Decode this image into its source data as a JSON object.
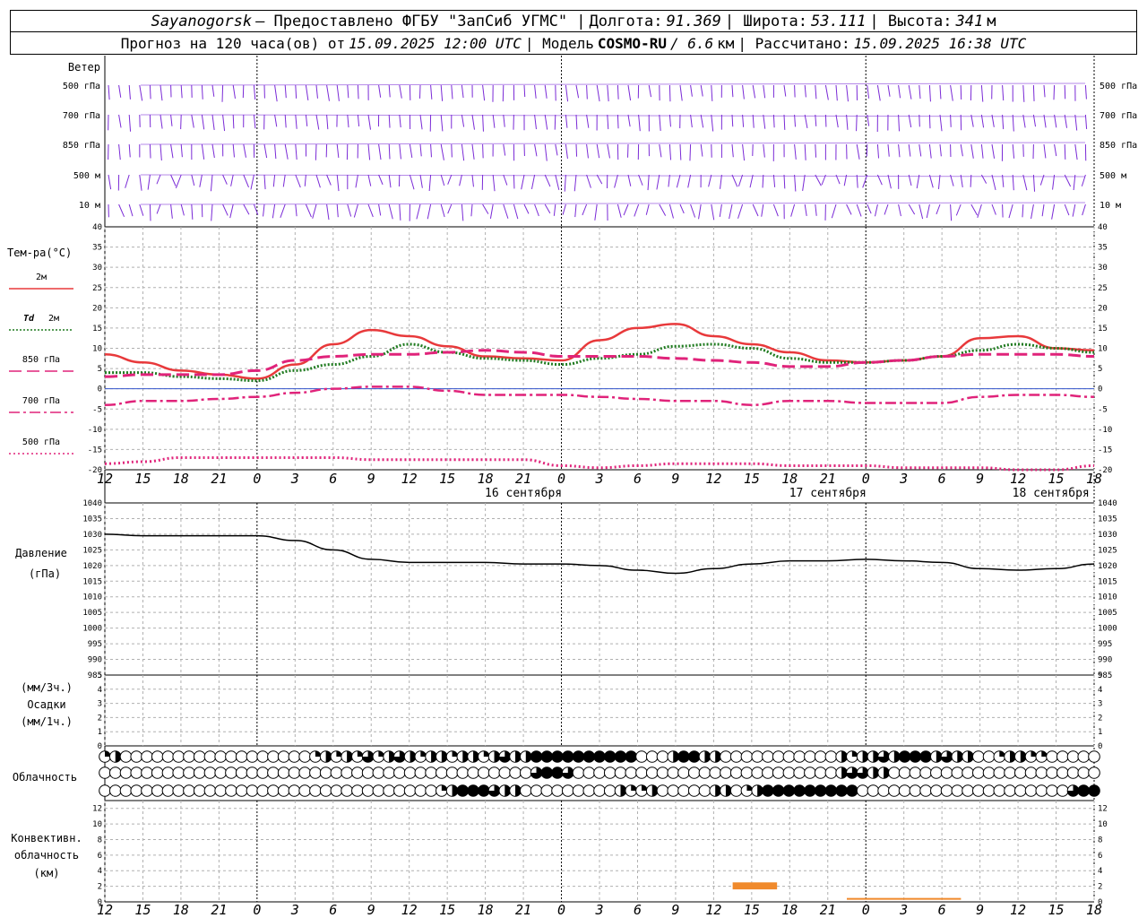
{
  "header": {
    "station": "Sayanogorsk",
    "provider": "— Предоставлено ФГБУ \"ЗапСиб УГМС\" |",
    "lon_label": "Долгота:",
    "lon_value": "91.369",
    "lat_label": "| Широта:",
    "lat_value": "53.111",
    "alt_label": "| Высота:",
    "alt_value": "341",
    "alt_unit": "м",
    "forecast_label": "Прогноз на 120 часа(ов) от",
    "forecast_start": "15.09.2025 12:00 UTC",
    "model_label": "| Модель",
    "model_name": "COSMO-RU",
    "model_res": "/ 6.6",
    "model_res_unit": "км",
    "computed_label": "| Рассчитано:",
    "computed_at": "15.09.2025 16:38 UTC"
  },
  "wind": {
    "title": "Ветер",
    "levels": [
      "500 гПа",
      "700 гПа",
      "850 гПа",
      "500 м",
      "10 м"
    ]
  },
  "temperature": {
    "title": "Тем-ра(°С)",
    "legend": [
      {
        "label": "2м",
        "label_td": "",
        "color": "#e8393b",
        "style": "solid"
      },
      {
        "label": "2м",
        "label_td": "Td",
        "color": "#1f7a1f",
        "style": "dotted"
      },
      {
        "label": "850 гПа",
        "label_td": "",
        "color": "#e0237a",
        "style": "dashed"
      },
      {
        "label": "700 гПа",
        "label_td": "",
        "color": "#e0237a",
        "style": "dashdot"
      },
      {
        "label": "500 гПа",
        "label_td": "",
        "color": "#e0237a",
        "style": "fine"
      }
    ],
    "yticks": [
      "40",
      "35",
      "30",
      "25",
      "20",
      "15",
      "10",
      "5",
      "0",
      "-5",
      "-10",
      "-15",
      "-20"
    ]
  },
  "time_axis": {
    "hour_ticks": [
      "12",
      "15",
      "18",
      "21",
      "0",
      "3",
      "6",
      "9",
      "12",
      "15",
      "18",
      "21",
      "0",
      "3",
      "6",
      "9",
      "12",
      "15",
      "18",
      "21",
      "0",
      "3",
      "6",
      "9",
      "12",
      "15",
      "18"
    ],
    "dates": [
      "16 сентября",
      "17 сентября",
      "18 сентября"
    ]
  },
  "pressure": {
    "title": "Давление",
    "unit": "(гПа)",
    "yticks": [
      "1040",
      "1035",
      "1030",
      "1025",
      "1020",
      "1015",
      "1010",
      "1005",
      "1000",
      "995",
      "990",
      "985"
    ]
  },
  "precip": {
    "unit3": "(мм/3ч.)",
    "title": "Осадки",
    "unit1": "(мм/1ч.)",
    "yticks": [
      "5",
      "4",
      "3",
      "2",
      "1",
      "0"
    ]
  },
  "clouds": {
    "title": "Облачность"
  },
  "convective": {
    "title1": "Конвективн.",
    "title2": "облачность",
    "unit": "(км)",
    "yticks": [
      "12",
      "10",
      "8",
      "6",
      "4",
      "2",
      "0"
    ]
  },
  "chart_data": {
    "type": "line",
    "x_hours_from_start": [
      0,
      3,
      6,
      9,
      12,
      15,
      18,
      21,
      24,
      27,
      30,
      33,
      36,
      39,
      42,
      45,
      48,
      51,
      54,
      57,
      60,
      63,
      66,
      69,
      72,
      75,
      78
    ],
    "x_tick_labels_utc": [
      "12",
      "15",
      "18",
      "21",
      "0",
      "3",
      "6",
      "9",
      "12",
      "15",
      "18",
      "21",
      "0",
      "3",
      "6",
      "9",
      "12",
      "15",
      "18",
      "21",
      "0",
      "3",
      "6",
      "9",
      "12",
      "15",
      "18"
    ],
    "temperature_panel": {
      "ylim": [
        -20,
        40
      ],
      "series": [
        {
          "name": "2м",
          "color": "#e8393b",
          "values": [
            8.5,
            6.5,
            4.5,
            3.5,
            2.5,
            6,
            11,
            14.5,
            13,
            10.5,
            8,
            7.5,
            7,
            12,
            15,
            16,
            13,
            11,
            9,
            7,
            6.5,
            7,
            8,
            12.5,
            13,
            10,
            9.5
          ]
        },
        {
          "name": "Td 2м",
          "color": "#1f7a1f",
          "values": [
            4,
            4,
            3,
            2.5,
            2,
            4.5,
            6,
            8,
            11,
            9,
            7.5,
            7,
            6,
            7.5,
            8.5,
            10.5,
            11,
            10,
            7.5,
            6.5,
            6.5,
            7,
            8,
            9.5,
            11,
            10,
            9
          ]
        },
        {
          "name": "850 гПа",
          "color": "#e0237a",
          "values": [
            3,
            3.5,
            3.5,
            3.5,
            4.5,
            7,
            8,
            8.5,
            8.5,
            9,
            9.5,
            9,
            8,
            8,
            8,
            7.5,
            7,
            6.5,
            5.5,
            5.5,
            6.5,
            7,
            8,
            8.5,
            8.5,
            8.5,
            8
          ]
        },
        {
          "name": "700 гПа",
          "color": "#e0237a",
          "values": [
            -4,
            -3,
            -3,
            -2.5,
            -2,
            -1,
            0,
            0.5,
            0.5,
            -0.5,
            -1.5,
            -1.5,
            -1.5,
            -2,
            -2.5,
            -3,
            -3,
            -4,
            -3,
            -3,
            -3.5,
            -3.5,
            -3.5,
            -2,
            -1.5,
            -1.5,
            -2
          ]
        },
        {
          "name": "500 гПа",
          "color": "#e0237a",
          "values": [
            -18.5,
            -18,
            -17,
            -17,
            -17,
            -17,
            -17,
            -17.5,
            -17.5,
            -17.5,
            -17.5,
            -17.5,
            -19,
            -19.5,
            -19,
            -18.5,
            -18.5,
            -18.5,
            -19,
            -19,
            -19,
            -19.5,
            -19.5,
            -19.5,
            -20,
            -20,
            -19
          ]
        }
      ]
    },
    "pressure_panel": {
      "ylim": [
        985,
        1040
      ],
      "series": [
        {
          "name": "Давление",
          "color": "#000000",
          "values": [
            1030,
            1029.5,
            1029.5,
            1029.5,
            1029.5,
            1028,
            1025,
            1022,
            1021,
            1021,
            1021,
            1020.5,
            1020.5,
            1020,
            1018.5,
            1017.5,
            1019,
            1020.5,
            1021.5,
            1021.5,
            1022,
            1021.5,
            1021,
            1019,
            1018.5,
            1019,
            1020.5
          ]
        }
      ]
    },
    "precip_panel": {
      "ylim": [
        0,
        5
      ],
      "values": []
    },
    "convective_panel": {
      "ylim": [
        0,
        13
      ],
      "bars": [
        {
          "x_start": 49.5,
          "x_end": 53,
          "base_km": 1.6,
          "top_km": 2.5,
          "color": "#f08a2c"
        },
        {
          "x_start": 58.5,
          "x_end": 67.5,
          "base_km": 0.3,
          "top_km": 0.5,
          "color": "#f08a2c"
        }
      ]
    },
    "cloud_cover": {
      "rows": [
        [
          1,
          2,
          0,
          0,
          0,
          0,
          0,
          0,
          0,
          0,
          0,
          0,
          0,
          0,
          0,
          0,
          0,
          0,
          0,
          0,
          1,
          2,
          1,
          2,
          1,
          3,
          1,
          2,
          3,
          2,
          1,
          2,
          2,
          1,
          2,
          2,
          1,
          2,
          3,
          2,
          2,
          4,
          4,
          4,
          4,
          4,
          4,
          4,
          4,
          4,
          4,
          0,
          0,
          0,
          2,
          4,
          4,
          2,
          2,
          0,
          0,
          0,
          0,
          0,
          0,
          0,
          0,
          0,
          0,
          0,
          2,
          1,
          2,
          2,
          3,
          2,
          4,
          4,
          4,
          2,
          3,
          2,
          2,
          0,
          0,
          1,
          2,
          2,
          1,
          1,
          0,
          0,
          0,
          0,
          0
        ],
        [
          0,
          0,
          0,
          0,
          0,
          0,
          0,
          0,
          0,
          0,
          0,
          0,
          0,
          0,
          0,
          0,
          0,
          0,
          0,
          0,
          0,
          0,
          0,
          0,
          0,
          0,
          0,
          0,
          0,
          0,
          0,
          0,
          0,
          0,
          0,
          0,
          0,
          0,
          0,
          0,
          0,
          3,
          4,
          4,
          3,
          0,
          0,
          0,
          0,
          0,
          0,
          0,
          0,
          0,
          0,
          0,
          0,
          0,
          0,
          0,
          0,
          0,
          0,
          0,
          0,
          0,
          0,
          0,
          0,
          0,
          2,
          3,
          3,
          2,
          2,
          0,
          0,
          0,
          0,
          0,
          0,
          0,
          0,
          0,
          0,
          0,
          0,
          0,
          0,
          0,
          0,
          0,
          0,
          0,
          0
        ],
        [
          0,
          0,
          0,
          0,
          0,
          0,
          0,
          0,
          0,
          0,
          0,
          0,
          0,
          0,
          0,
          0,
          0,
          0,
          0,
          0,
          0,
          0,
          0,
          0,
          0,
          0,
          0,
          0,
          0,
          0,
          0,
          0,
          1,
          2,
          4,
          4,
          4,
          3,
          2,
          2,
          0,
          0,
          0,
          0,
          0,
          0,
          0,
          0,
          0,
          2,
          1,
          1,
          2,
          0,
          0,
          0,
          0,
          0,
          2,
          2,
          0,
          1,
          2,
          4,
          4,
          4,
          4,
          4,
          4,
          4,
          4,
          4,
          0,
          0,
          0,
          0,
          0,
          0,
          0,
          0,
          0,
          0,
          0,
          0,
          0,
          0,
          0,
          0,
          0,
          0,
          0,
          0,
          3,
          4,
          4
        ]
      ]
    }
  }
}
